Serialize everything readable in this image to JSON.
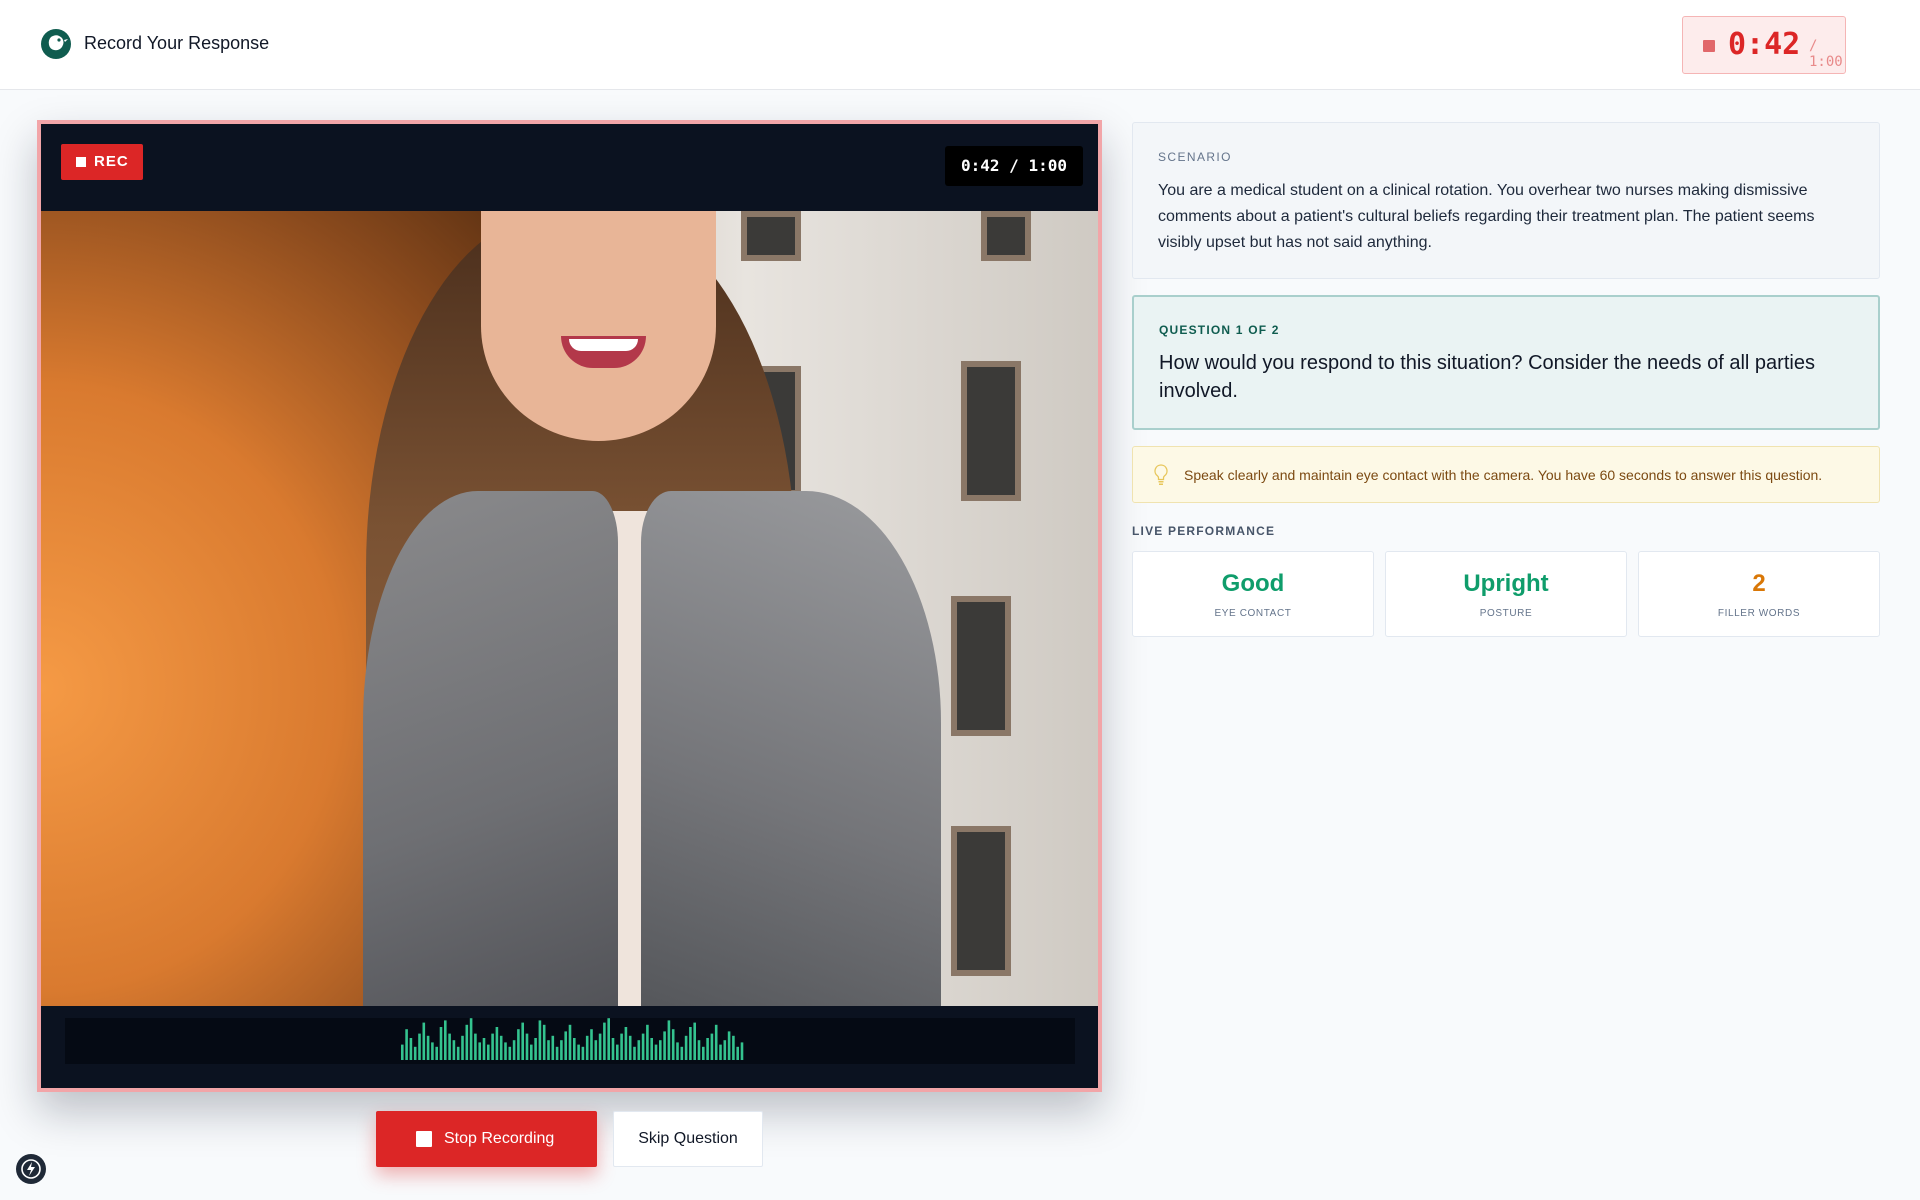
{
  "header": {
    "title": "Record Your Response",
    "timer_elapsed": "0:42",
    "timer_total": "/ 1:00"
  },
  "video": {
    "rec_label": "REC",
    "timer": "0:42 / 1:00",
    "audio_levels": [
      0.35,
      0.7,
      0.5,
      0.3,
      0.6,
      0.85,
      0.55,
      0.4,
      0.3,
      0.75,
      0.9,
      0.6,
      0.45,
      0.3,
      0.55,
      0.8,
      0.95,
      0.6,
      0.4,
      0.5,
      0.35,
      0.6,
      0.75,
      0.55,
      0.4,
      0.3,
      0.45,
      0.7,
      0.85,
      0.6,
      0.35,
      0.5,
      0.9,
      0.8,
      0.45,
      0.55,
      0.3,
      0.45,
      0.65,
      0.8,
      0.5,
      0.35,
      0.3,
      0.55,
      0.7,
      0.45,
      0.6,
      0.85,
      0.95,
      0.5,
      0.35,
      0.6,
      0.75,
      0.55,
      0.3,
      0.45,
      0.6,
      0.8,
      0.5,
      0.35,
      0.45,
      0.65,
      0.9,
      0.7,
      0.4,
      0.3,
      0.55,
      0.75,
      0.85,
      0.45,
      0.3,
      0.5,
      0.6,
      0.8,
      0.35,
      0.45,
      0.65,
      0.55,
      0.3,
      0.4
    ],
    "wave_color": "#34c38f"
  },
  "actions": {
    "stop_label": "Stop Recording",
    "skip_label": "Skip Question"
  },
  "scenario": {
    "label": "SCENARIO",
    "text": "You are a medical student on a clinical rotation. You overhear two nurses making dismissive comments about a patient's cultural beliefs regarding their treatment plan. The patient seems visibly upset but has not said anything."
  },
  "question": {
    "label": "QUESTION 1 OF 2",
    "text": "How would you respond to this situation? Consider the needs of all parties involved."
  },
  "tip": {
    "text": "Speak clearly and maintain eye contact with the camera. You have 60 seconds to answer this question."
  },
  "performance": {
    "label": "LIVE PERFORMANCE",
    "metrics": [
      {
        "value": "Good",
        "caption": "EYE CONTACT",
        "color": "#0f9d6b"
      },
      {
        "value": "Upright",
        "caption": "POSTURE",
        "color": "#0f9d6b"
      },
      {
        "value": "2",
        "caption": "FILLER WORDS",
        "color": "#d97706"
      }
    ]
  },
  "colors": {
    "accent_red": "#dc2626",
    "teal": "#0f5c4f"
  }
}
